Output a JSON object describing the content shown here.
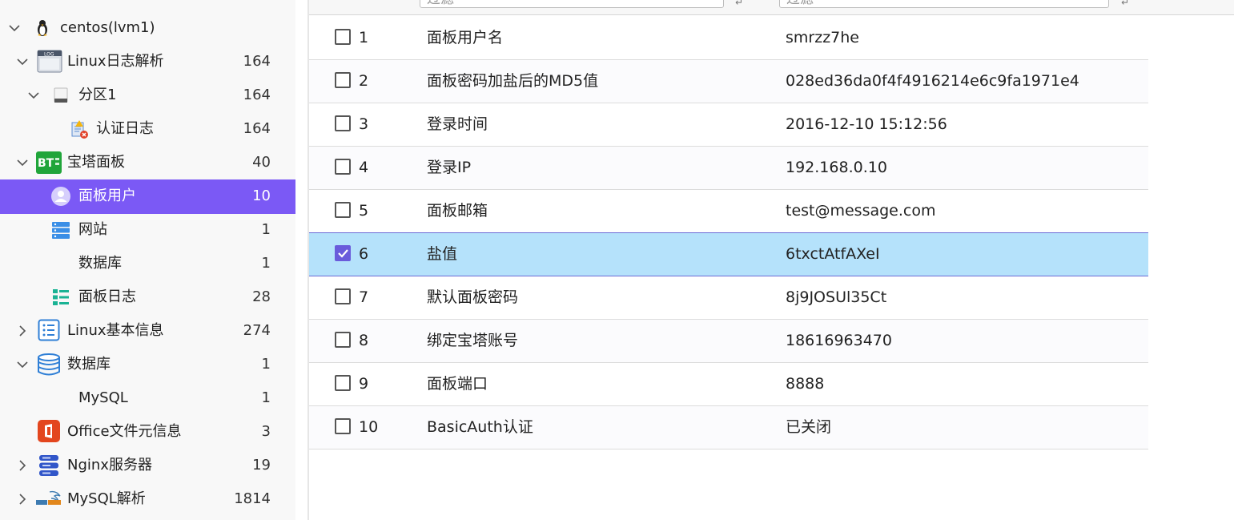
{
  "tree": [
    {
      "label": "centos(lvm1)",
      "count": "",
      "icon": "linux-penguin-icon",
      "expanded": true
    },
    {
      "label": "Linux日志解析",
      "count": "164",
      "icon": "log-file-icon",
      "expanded": true
    },
    {
      "label": "分区1",
      "count": "164",
      "icon": "drive-icon",
      "expanded": true
    },
    {
      "label": "认证日志",
      "count": "164",
      "icon": "auth-log-icon"
    },
    {
      "label": "宝塔面板",
      "count": "40",
      "icon": "bt-panel-icon",
      "expanded": true
    },
    {
      "label": "面板用户",
      "count": "10",
      "icon": "user-icon",
      "selected": true
    },
    {
      "label": "网站",
      "count": "1",
      "icon": "server-icon"
    },
    {
      "label": "数据库",
      "count": "1",
      "icon": ""
    },
    {
      "label": "面板日志",
      "count": "28",
      "icon": "list-log-icon"
    },
    {
      "label": "Linux基本信息",
      "count": "274",
      "icon": "info-list-icon",
      "expanded": false
    },
    {
      "label": "数据库",
      "count": "1",
      "icon": "database-icon",
      "expanded": true
    },
    {
      "label": "MySQL",
      "count": "1",
      "icon": ""
    },
    {
      "label": "Office文件元信息",
      "count": "3",
      "icon": "office-icon"
    },
    {
      "label": "Nginx服务器",
      "count": "19",
      "icon": "nginx-server-icon",
      "expanded": false
    },
    {
      "label": "MySQL解析",
      "count": "1814",
      "icon": "mysql-logo-icon",
      "expanded": false
    }
  ],
  "filter": {
    "placeholder_1": "过滤",
    "placeholder_2": "过滤"
  },
  "rows": [
    {
      "num": "1",
      "key": "面板用户名",
      "value": "smrzz7he",
      "checked": false
    },
    {
      "num": "2",
      "key": "面板密码加盐后的MD5值",
      "value": "028ed36da0f4f4916214e6c9fa1971e4",
      "checked": false
    },
    {
      "num": "3",
      "key": "登录时间",
      "value": "2016-12-10 15:12:56",
      "checked": false
    },
    {
      "num": "4",
      "key": "登录IP",
      "value": "192.168.0.10",
      "checked": false
    },
    {
      "num": "5",
      "key": "面板邮箱",
      "value": "test@message.com",
      "checked": false
    },
    {
      "num": "6",
      "key": "盐值",
      "value": "6txctAtfAXeI",
      "checked": true
    },
    {
      "num": "7",
      "key": "默认面板密码",
      "value": "8j9JOSUl35Ct",
      "checked": false
    },
    {
      "num": "8",
      "key": "绑定宝塔账号",
      "value": "18616963470",
      "checked": false
    },
    {
      "num": "9",
      "key": "面板端口",
      "value": "8888",
      "checked": false
    },
    {
      "num": "10",
      "key": "BasicAuth认证",
      "value": "已关闭",
      "checked": false
    }
  ],
  "colors": {
    "selected": "#7b59f5",
    "checked_row": "#b5e2fb",
    "accent": "#6a5bdb"
  }
}
